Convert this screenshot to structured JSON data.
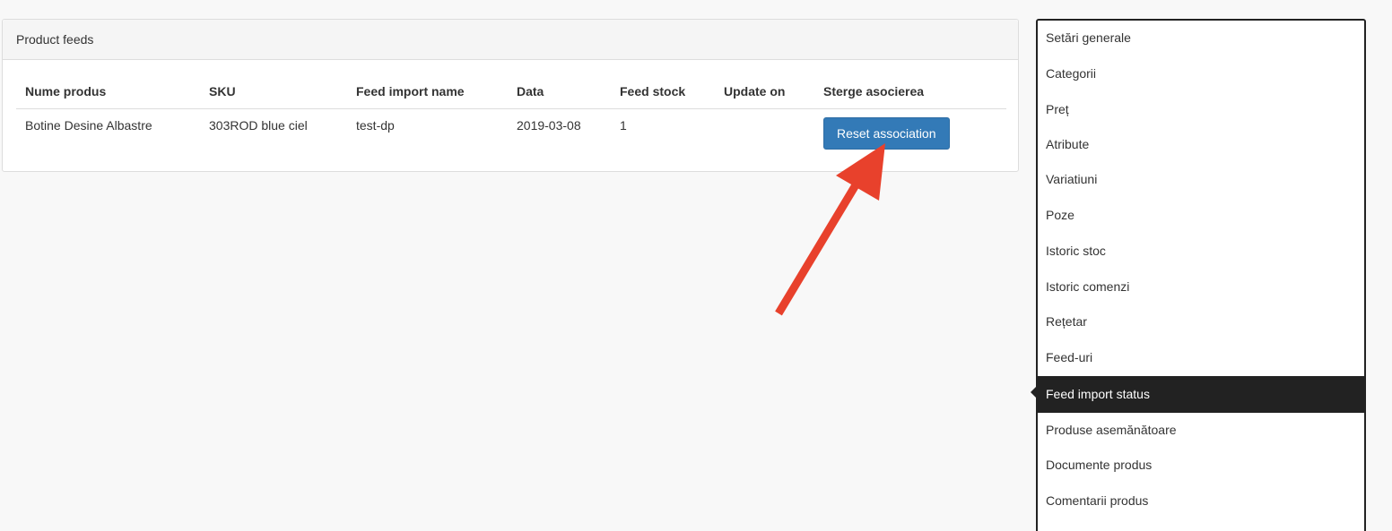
{
  "panel": {
    "title": "Product feeds",
    "columns": [
      "Nume produs",
      "SKU",
      "Feed import name",
      "Data",
      "Feed stock",
      "Update on",
      "Sterge asocierea"
    ],
    "rows": [
      {
        "name": "Botine Desine Albastre",
        "sku": "303ROD blue ciel",
        "feed_import_name": "test-dp",
        "data": "2019-03-08",
        "feed_stock": "1",
        "update_on": "",
        "action_label": "Reset association"
      }
    ]
  },
  "sidebar": {
    "items": [
      {
        "label": "Setări generale",
        "active": false
      },
      {
        "label": "Categorii",
        "active": false
      },
      {
        "label": "Preț",
        "active": false
      },
      {
        "label": "Atribute",
        "active": false
      },
      {
        "label": "Variatiuni",
        "active": false
      },
      {
        "label": "Poze",
        "active": false
      },
      {
        "label": "Istoric stoc",
        "active": false
      },
      {
        "label": "Istoric comenzi",
        "active": false
      },
      {
        "label": "Rețetar",
        "active": false
      },
      {
        "label": "Feed-uri",
        "active": false
      },
      {
        "label": "Feed import status",
        "active": true
      },
      {
        "label": "Produse asemănătoare",
        "active": false
      },
      {
        "label": "Documente produs",
        "active": false
      },
      {
        "label": "Comentarii produs",
        "active": false
      }
    ]
  },
  "colors": {
    "primary_button": "#337ab7",
    "active_nav": "#222222",
    "annotation_arrow": "#e8412c"
  }
}
